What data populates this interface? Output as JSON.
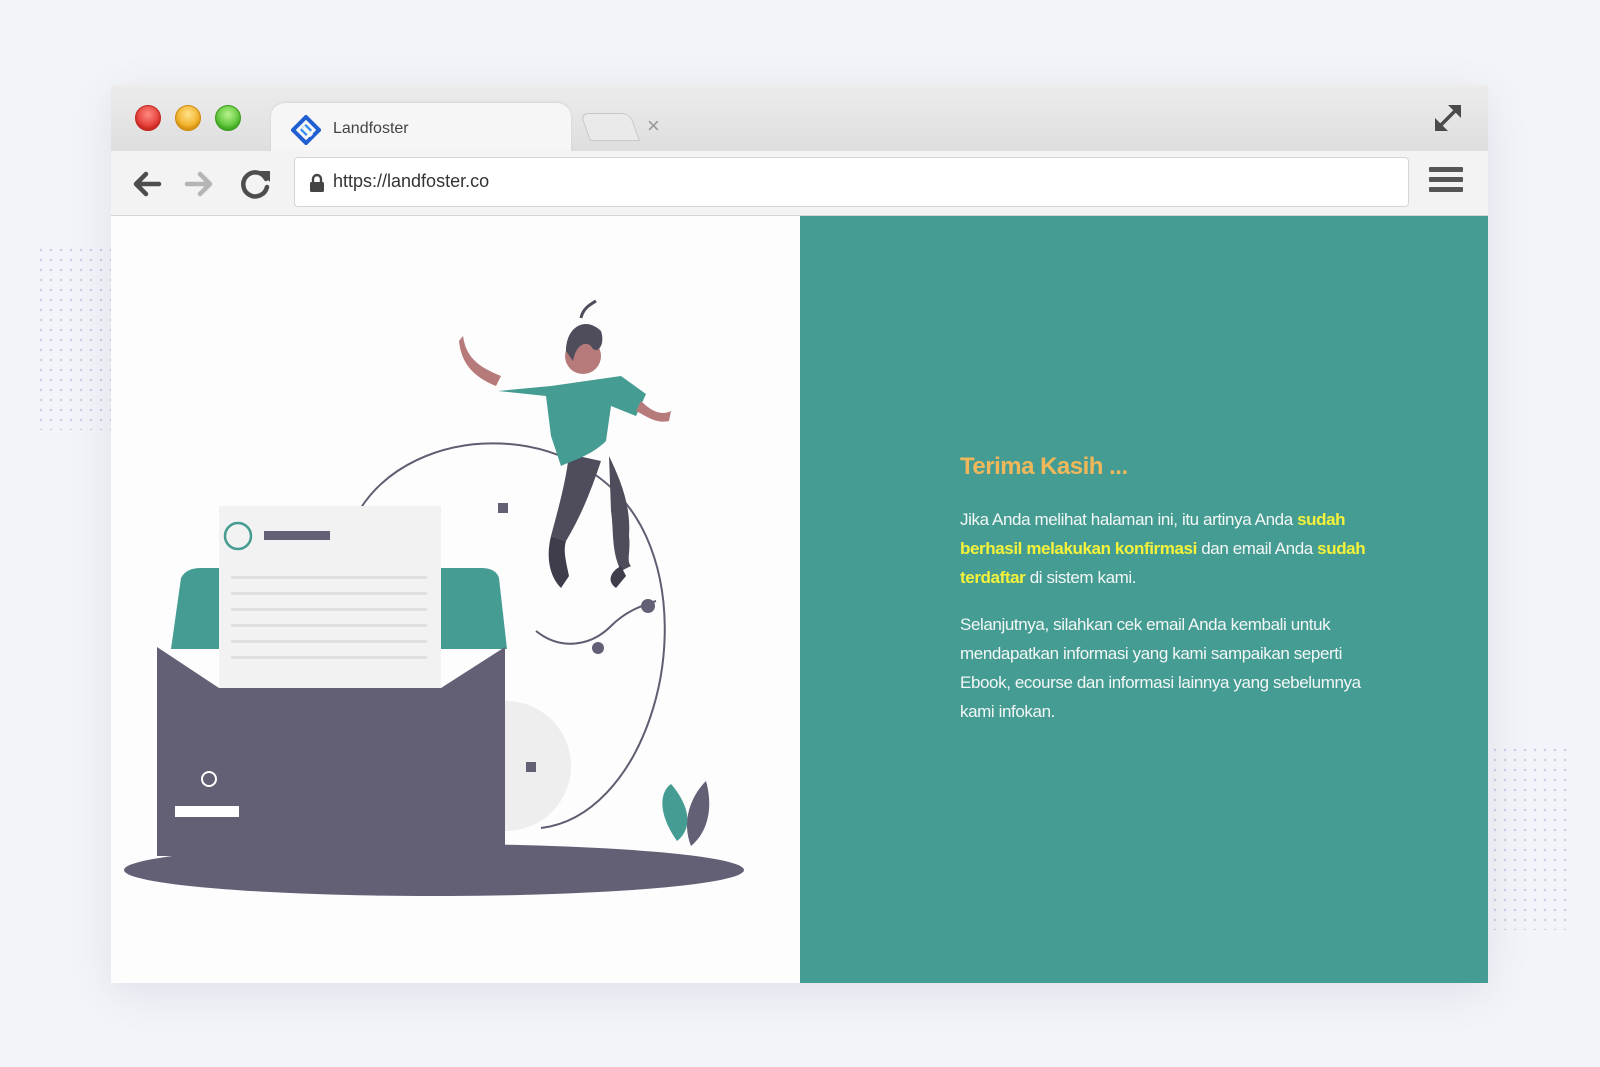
{
  "browser": {
    "tab_title": "Landfoster",
    "tab_close": "×",
    "url": "https://landfoster.co"
  },
  "message": {
    "title": "Terima Kasih ...",
    "p1_a": "Jika Anda melihat halaman ini, itu artinya Anda ",
    "p1_hl1": "sudah berhasil melakukan konfirmasi",
    "p1_b": " dan email Anda ",
    "p1_hl2": "sudah terdaftar",
    "p1_c": " di sistem kami.",
    "p2": "Selanjutnya, silahkan cek email Anda kembali untuk mendapatkan informasi yang kami sampaikan seperti Ebook, ecourse dan informasi lainnya yang sebelumnya kami infokan."
  },
  "icons": [
    "back-arrow-icon",
    "forward-arrow-icon",
    "reload-icon",
    "lock-icon",
    "hamburger-menu-icon",
    "maximize-icon",
    "landfoster-logo-icon",
    "close-icon"
  ],
  "colors": {
    "accent_teal": "#459c92",
    "title_orange": "#f0b85a",
    "highlight_yellow": "#f6f23a",
    "illustration_dark": "#636076"
  }
}
